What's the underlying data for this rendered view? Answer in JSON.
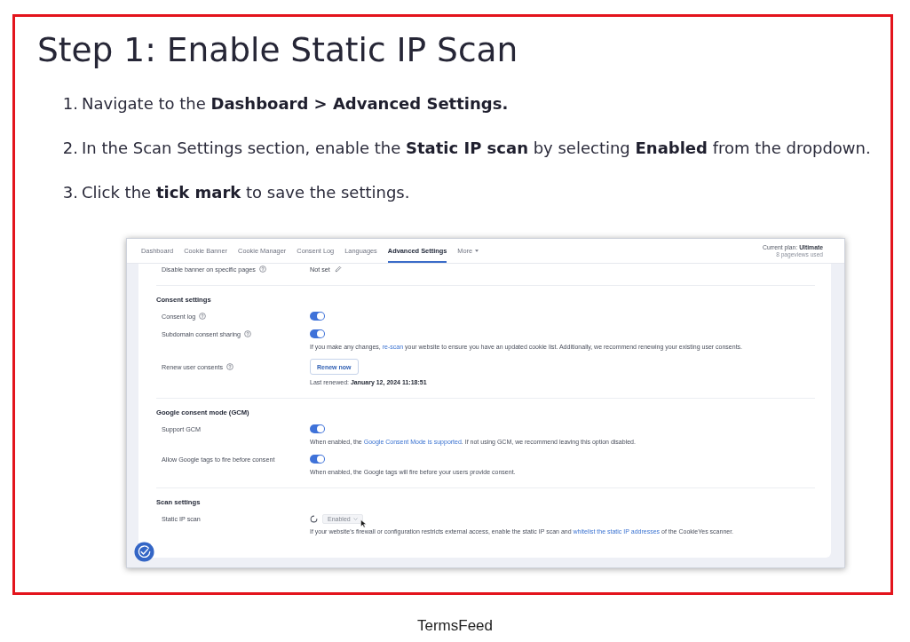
{
  "heading": "Step 1: Enable Static IP Scan",
  "steps": [
    {
      "number": "1.",
      "text": "Navigate to the **Dashboard > Advanced Settings.**"
    },
    {
      "number": "2.",
      "text": "In the Scan Settings section, enable the **Static IP scan** by selecting **Enabled** from the dropdown."
    },
    {
      "number": "3.",
      "text": "Click the **tick mark** to save the settings."
    }
  ],
  "screenshot": {
    "nav": {
      "tabs": [
        {
          "label": "Dashboard",
          "selected": false
        },
        {
          "label": "Cookie Banner",
          "selected": false
        },
        {
          "label": "Cookie Manager",
          "selected": false
        },
        {
          "label": "Consent Log",
          "selected": false
        },
        {
          "label": "Languages",
          "selected": false
        },
        {
          "label": "Advanced Settings",
          "selected": true
        }
      ],
      "menu": "More",
      "plan": "Current plan: **Ultimate**",
      "usage": "8 pageviews used"
    },
    "sections": [
      {
        "rows": [
          {
            "kind": "value",
            "label": "Disable banner on specific pages",
            "help": true,
            "value": "Not set"
          }
        ]
      },
      {
        "title": "Consent settings",
        "rows": [
          {
            "kind": "toggle",
            "label": "Consent log",
            "help": true,
            "on": true
          },
          {
            "kind": "toggle",
            "label": "Subdomain consent sharing",
            "help": true,
            "on": true,
            "note": [
              {
                "text": "If you make any changes, ",
                "link": false
              },
              {
                "text": "re-scan",
                "link": true
              },
              {
                "text": " your website to ensure you have an updated cookie list. Additionally, we recommend renewing your existing user consents.",
                "link": false
              }
            ]
          },
          {
            "kind": "button",
            "label": "Renew user consents",
            "help": true,
            "button": "Renew now",
            "note": [
              {
                "text": "Last renewed: **January 12, 2024 11:18:51**",
                "link": false
              }
            ]
          }
        ]
      },
      {
        "title": "Google consent mode (GCM)",
        "rows": [
          {
            "kind": "toggle",
            "label": "Support GCM",
            "help": false,
            "on": true,
            "note": [
              {
                "text": "When enabled, the ",
                "link": false
              },
              {
                "text": "Google Consent Mode is supported",
                "link": true
              },
              {
                "text": ". If not using GCM, we recommend leaving this option disabled.",
                "link": false
              }
            ]
          },
          {
            "kind": "toggle",
            "label": "Allow Google tags to fire before consent",
            "help": false,
            "on": true,
            "note": [
              {
                "text": "When enabled, the Google tags will fire before your users provide consent.",
                "link": false
              }
            ]
          }
        ]
      },
      {
        "title": "Scan settings",
        "rows": [
          {
            "kind": "select",
            "label": "Static IP scan",
            "help": false,
            "value": "Enabled",
            "loading": true,
            "note": [
              {
                "text": "If your website's firewall or configuration restricts external access, enable the static IP scan and ",
                "link": false
              },
              {
                "text": "whitelist the static IP addresses",
                "link": true
              },
              {
                "text": " of the CookieYes scanner.",
                "link": false
              }
            ]
          }
        ]
      }
    ]
  },
  "caption": "TermsFeed"
}
